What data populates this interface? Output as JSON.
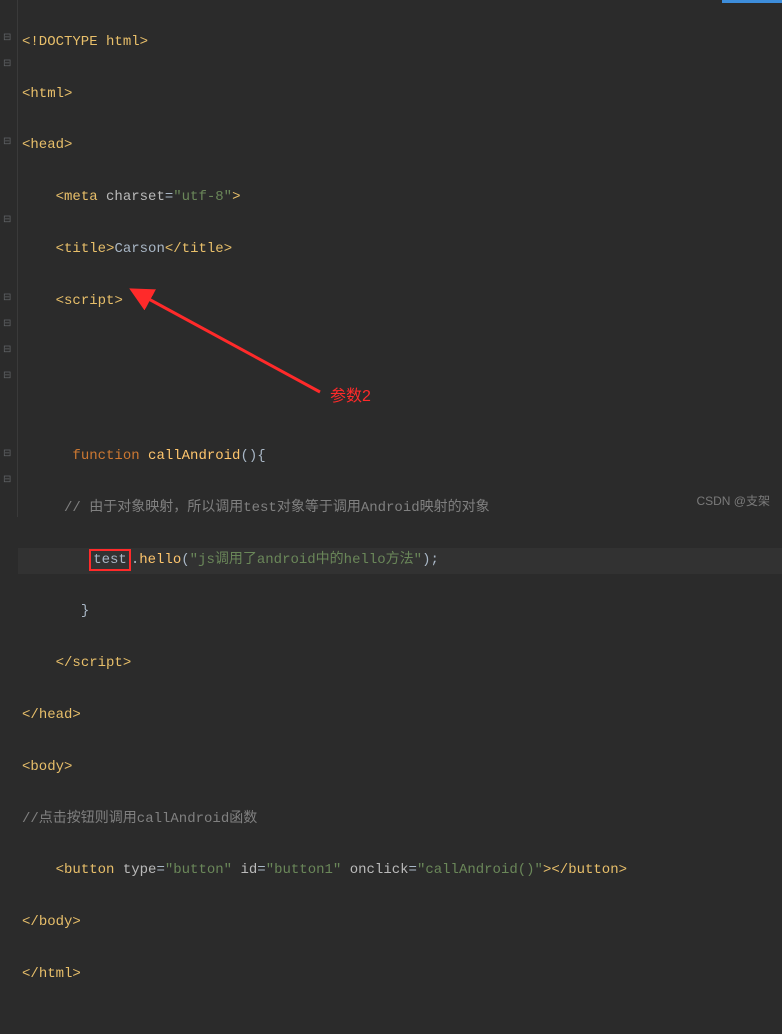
{
  "code": {
    "l1": "<!DOCTYPE html>",
    "l2_open": "<",
    "l2_tag": "html",
    "l2_close": ">",
    "l3_open": "<",
    "l3_tag": "head",
    "l3_close": ">",
    "l4_indent": "    ",
    "l4_open": "<",
    "l4_tag": "meta ",
    "l4_attr": "charset",
    "l4_eq": "=",
    "l4_val": "\"utf-8\"",
    "l4_close": ">",
    "l5_indent": "    ",
    "l5_open": "<",
    "l5_tag": "title",
    "l5_close": ">",
    "l5_text": "Carson",
    "l5_c_open": "</",
    "l5_c_tag": "title",
    "l5_c_close": ">",
    "l6_indent": "    ",
    "l6_open": "<",
    "l6_tag": "script",
    "l6_close": ">",
    "l9_indent": "      ",
    "l9_kw": "function ",
    "l9_fn": "callAndroid",
    "l9_rest": "(){",
    "l10_indent": "     ",
    "l10_comment": "// 由于对象映射，所以调用test对象等于调用Android映射的对象",
    "l11_indent": "        ",
    "l11_test": "test",
    "l11_dot": ".",
    "l11_method": "hello",
    "l11_paren": "(",
    "l11_str": "\"js调用了android中的hello方法\"",
    "l11_end": ");",
    "l12_indent": "       ",
    "l12_brace": "}",
    "l13_indent": "    ",
    "l13_open": "</",
    "l13_tag": "script",
    "l13_close": ">",
    "l14_open": "</",
    "l14_tag": "head",
    "l14_close": ">",
    "l15_open": "<",
    "l15_tag": "body",
    "l15_close": ">",
    "l16_comment": "//点击按钮则调用callAndroid函数",
    "l17_indent": "    ",
    "l17_open": "<",
    "l17_tag": "button ",
    "l17_a1": "type",
    "l17_v1": "\"button\"",
    "l17_a2": "id",
    "l17_v2": "\"button1\"",
    "l17_a3": "onclick",
    "l17_v3": "\"callAndroid()\"",
    "l17_mid": "></",
    "l17_ctag": "button",
    "l17_cend": ">",
    "l18_open": "</",
    "l18_tag": "body",
    "l18_close": ">",
    "l19_open": "</",
    "l19_tag": "html",
    "l19_close": ">"
  },
  "annotation": {
    "label": "参数2"
  },
  "watermark": "CSDN @支架"
}
